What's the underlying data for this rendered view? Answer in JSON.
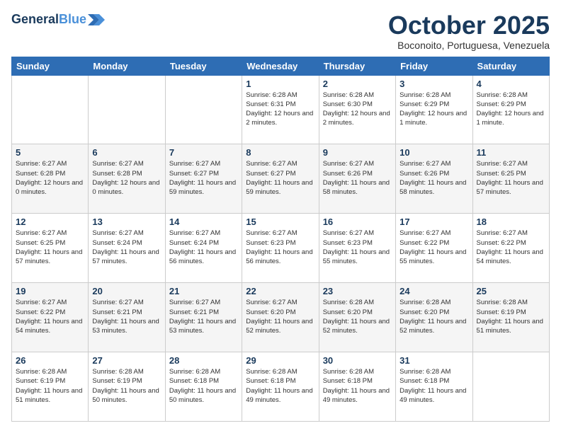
{
  "header": {
    "logo_line1": "General",
    "logo_line2": "Blue",
    "month": "October 2025",
    "location": "Boconoito, Portuguesa, Venezuela"
  },
  "weekdays": [
    "Sunday",
    "Monday",
    "Tuesday",
    "Wednesday",
    "Thursday",
    "Friday",
    "Saturday"
  ],
  "weeks": [
    [
      {
        "day": "",
        "sunrise": "",
        "sunset": "",
        "daylight": ""
      },
      {
        "day": "",
        "sunrise": "",
        "sunset": "",
        "daylight": ""
      },
      {
        "day": "",
        "sunrise": "",
        "sunset": "",
        "daylight": ""
      },
      {
        "day": "1",
        "sunrise": "Sunrise: 6:28 AM",
        "sunset": "Sunset: 6:31 PM",
        "daylight": "Daylight: 12 hours and 2 minutes."
      },
      {
        "day": "2",
        "sunrise": "Sunrise: 6:28 AM",
        "sunset": "Sunset: 6:30 PM",
        "daylight": "Daylight: 12 hours and 2 minutes."
      },
      {
        "day": "3",
        "sunrise": "Sunrise: 6:28 AM",
        "sunset": "Sunset: 6:29 PM",
        "daylight": "Daylight: 12 hours and 1 minute."
      },
      {
        "day": "4",
        "sunrise": "Sunrise: 6:28 AM",
        "sunset": "Sunset: 6:29 PM",
        "daylight": "Daylight: 12 hours and 1 minute."
      }
    ],
    [
      {
        "day": "5",
        "sunrise": "Sunrise: 6:27 AM",
        "sunset": "Sunset: 6:28 PM",
        "daylight": "Daylight: 12 hours and 0 minutes."
      },
      {
        "day": "6",
        "sunrise": "Sunrise: 6:27 AM",
        "sunset": "Sunset: 6:28 PM",
        "daylight": "Daylight: 12 hours and 0 minutes."
      },
      {
        "day": "7",
        "sunrise": "Sunrise: 6:27 AM",
        "sunset": "Sunset: 6:27 PM",
        "daylight": "Daylight: 11 hours and 59 minutes."
      },
      {
        "day": "8",
        "sunrise": "Sunrise: 6:27 AM",
        "sunset": "Sunset: 6:27 PM",
        "daylight": "Daylight: 11 hours and 59 minutes."
      },
      {
        "day": "9",
        "sunrise": "Sunrise: 6:27 AM",
        "sunset": "Sunset: 6:26 PM",
        "daylight": "Daylight: 11 hours and 58 minutes."
      },
      {
        "day": "10",
        "sunrise": "Sunrise: 6:27 AM",
        "sunset": "Sunset: 6:26 PM",
        "daylight": "Daylight: 11 hours and 58 minutes."
      },
      {
        "day": "11",
        "sunrise": "Sunrise: 6:27 AM",
        "sunset": "Sunset: 6:25 PM",
        "daylight": "Daylight: 11 hours and 57 minutes."
      }
    ],
    [
      {
        "day": "12",
        "sunrise": "Sunrise: 6:27 AM",
        "sunset": "Sunset: 6:25 PM",
        "daylight": "Daylight: 11 hours and 57 minutes."
      },
      {
        "day": "13",
        "sunrise": "Sunrise: 6:27 AM",
        "sunset": "Sunset: 6:24 PM",
        "daylight": "Daylight: 11 hours and 57 minutes."
      },
      {
        "day": "14",
        "sunrise": "Sunrise: 6:27 AM",
        "sunset": "Sunset: 6:24 PM",
        "daylight": "Daylight: 11 hours and 56 minutes."
      },
      {
        "day": "15",
        "sunrise": "Sunrise: 6:27 AM",
        "sunset": "Sunset: 6:23 PM",
        "daylight": "Daylight: 11 hours and 56 minutes."
      },
      {
        "day": "16",
        "sunrise": "Sunrise: 6:27 AM",
        "sunset": "Sunset: 6:23 PM",
        "daylight": "Daylight: 11 hours and 55 minutes."
      },
      {
        "day": "17",
        "sunrise": "Sunrise: 6:27 AM",
        "sunset": "Sunset: 6:22 PM",
        "daylight": "Daylight: 11 hours and 55 minutes."
      },
      {
        "day": "18",
        "sunrise": "Sunrise: 6:27 AM",
        "sunset": "Sunset: 6:22 PM",
        "daylight": "Daylight: 11 hours and 54 minutes."
      }
    ],
    [
      {
        "day": "19",
        "sunrise": "Sunrise: 6:27 AM",
        "sunset": "Sunset: 6:22 PM",
        "daylight": "Daylight: 11 hours and 54 minutes."
      },
      {
        "day": "20",
        "sunrise": "Sunrise: 6:27 AM",
        "sunset": "Sunset: 6:21 PM",
        "daylight": "Daylight: 11 hours and 53 minutes."
      },
      {
        "day": "21",
        "sunrise": "Sunrise: 6:27 AM",
        "sunset": "Sunset: 6:21 PM",
        "daylight": "Daylight: 11 hours and 53 minutes."
      },
      {
        "day": "22",
        "sunrise": "Sunrise: 6:27 AM",
        "sunset": "Sunset: 6:20 PM",
        "daylight": "Daylight: 11 hours and 52 minutes."
      },
      {
        "day": "23",
        "sunrise": "Sunrise: 6:28 AM",
        "sunset": "Sunset: 6:20 PM",
        "daylight": "Daylight: 11 hours and 52 minutes."
      },
      {
        "day": "24",
        "sunrise": "Sunrise: 6:28 AM",
        "sunset": "Sunset: 6:20 PM",
        "daylight": "Daylight: 11 hours and 52 minutes."
      },
      {
        "day": "25",
        "sunrise": "Sunrise: 6:28 AM",
        "sunset": "Sunset: 6:19 PM",
        "daylight": "Daylight: 11 hours and 51 minutes."
      }
    ],
    [
      {
        "day": "26",
        "sunrise": "Sunrise: 6:28 AM",
        "sunset": "Sunset: 6:19 PM",
        "daylight": "Daylight: 11 hours and 51 minutes."
      },
      {
        "day": "27",
        "sunrise": "Sunrise: 6:28 AM",
        "sunset": "Sunset: 6:19 PM",
        "daylight": "Daylight: 11 hours and 50 minutes."
      },
      {
        "day": "28",
        "sunrise": "Sunrise: 6:28 AM",
        "sunset": "Sunset: 6:18 PM",
        "daylight": "Daylight: 11 hours and 50 minutes."
      },
      {
        "day": "29",
        "sunrise": "Sunrise: 6:28 AM",
        "sunset": "Sunset: 6:18 PM",
        "daylight": "Daylight: 11 hours and 49 minutes."
      },
      {
        "day": "30",
        "sunrise": "Sunrise: 6:28 AM",
        "sunset": "Sunset: 6:18 PM",
        "daylight": "Daylight: 11 hours and 49 minutes."
      },
      {
        "day": "31",
        "sunrise": "Sunrise: 6:28 AM",
        "sunset": "Sunset: 6:18 PM",
        "daylight": "Daylight: 11 hours and 49 minutes."
      },
      {
        "day": "",
        "sunrise": "",
        "sunset": "",
        "daylight": ""
      }
    ]
  ]
}
